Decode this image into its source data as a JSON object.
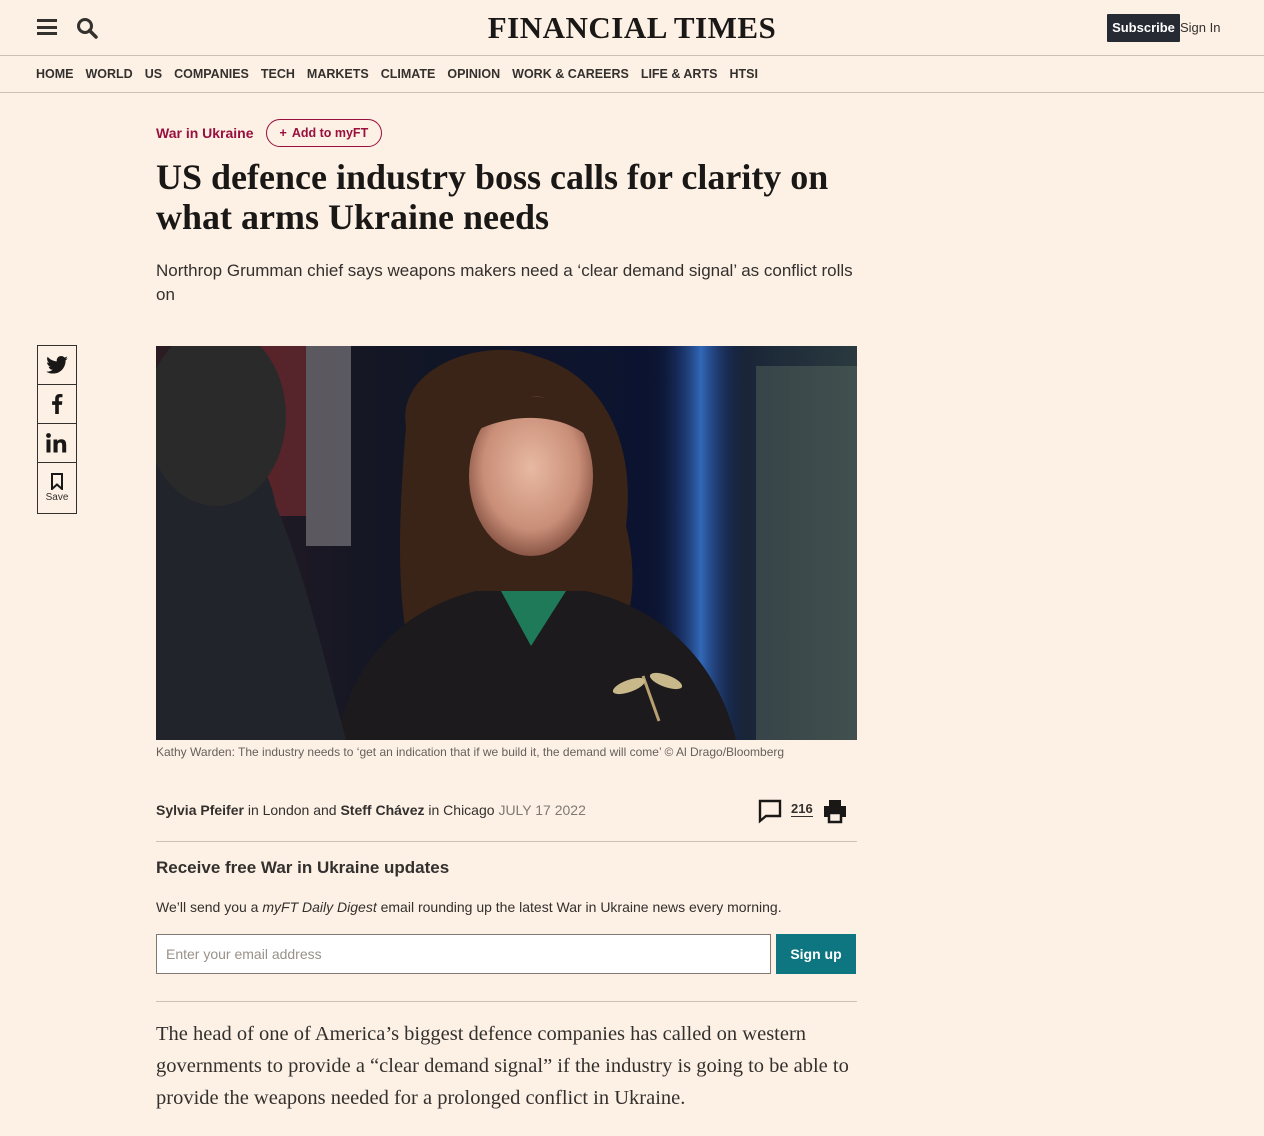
{
  "header": {
    "masthead": "FINANCIAL TIMES",
    "subscribe_label": "Subscribe",
    "signin_label": "Sign In"
  },
  "nav": {
    "items": [
      "HOME",
      "WORLD",
      "US",
      "COMPANIES",
      "TECH",
      "MARKETS",
      "CLIMATE",
      "OPINION",
      "WORK & CAREERS",
      "LIFE & ARTS",
      "HTSI"
    ]
  },
  "share": {
    "save_label": "Save"
  },
  "article": {
    "topic": "War in Ukraine",
    "add_myft_label": "Add to myFT",
    "headline": "US defence industry boss calls for clarity on what arms Ukraine needs",
    "standfirst": "Northrop Grumman chief says weapons makers need a ‘clear demand signal’ as conflict rolls on",
    "caption": "Kathy Warden: The industry needs to ‘get an indication that if we build it, the demand will come’ © Al Drago/Bloomberg",
    "byline": {
      "author1": "Sylvia Pfeifer",
      "loc1": " in London and ",
      "author2": "Steff Chávez",
      "loc2": " in Chicago ",
      "date": "JULY 17 2022"
    },
    "comments_count": "216",
    "body_first_paragraph": "The head of one of America’s biggest defence companies has called on western governments to provide a “clear demand signal” if the industry is going to be able to provide the weapons needed for a prolonged conflict in Ukraine."
  },
  "newsletter": {
    "title": "Receive free War in Ukraine updates",
    "text_before": "We’ll send you a ",
    "text_italic": "myFT Daily Digest",
    "text_after": " email rounding up the latest War in Ukraine news every morning.",
    "email_placeholder": "Enter your email address",
    "signup_label": "Sign up"
  },
  "colors": {
    "background": "#fdf1e5",
    "accent_claret": "#990f3d",
    "signup_teal": "#0d7680",
    "subscribe_dark": "#262a33"
  }
}
